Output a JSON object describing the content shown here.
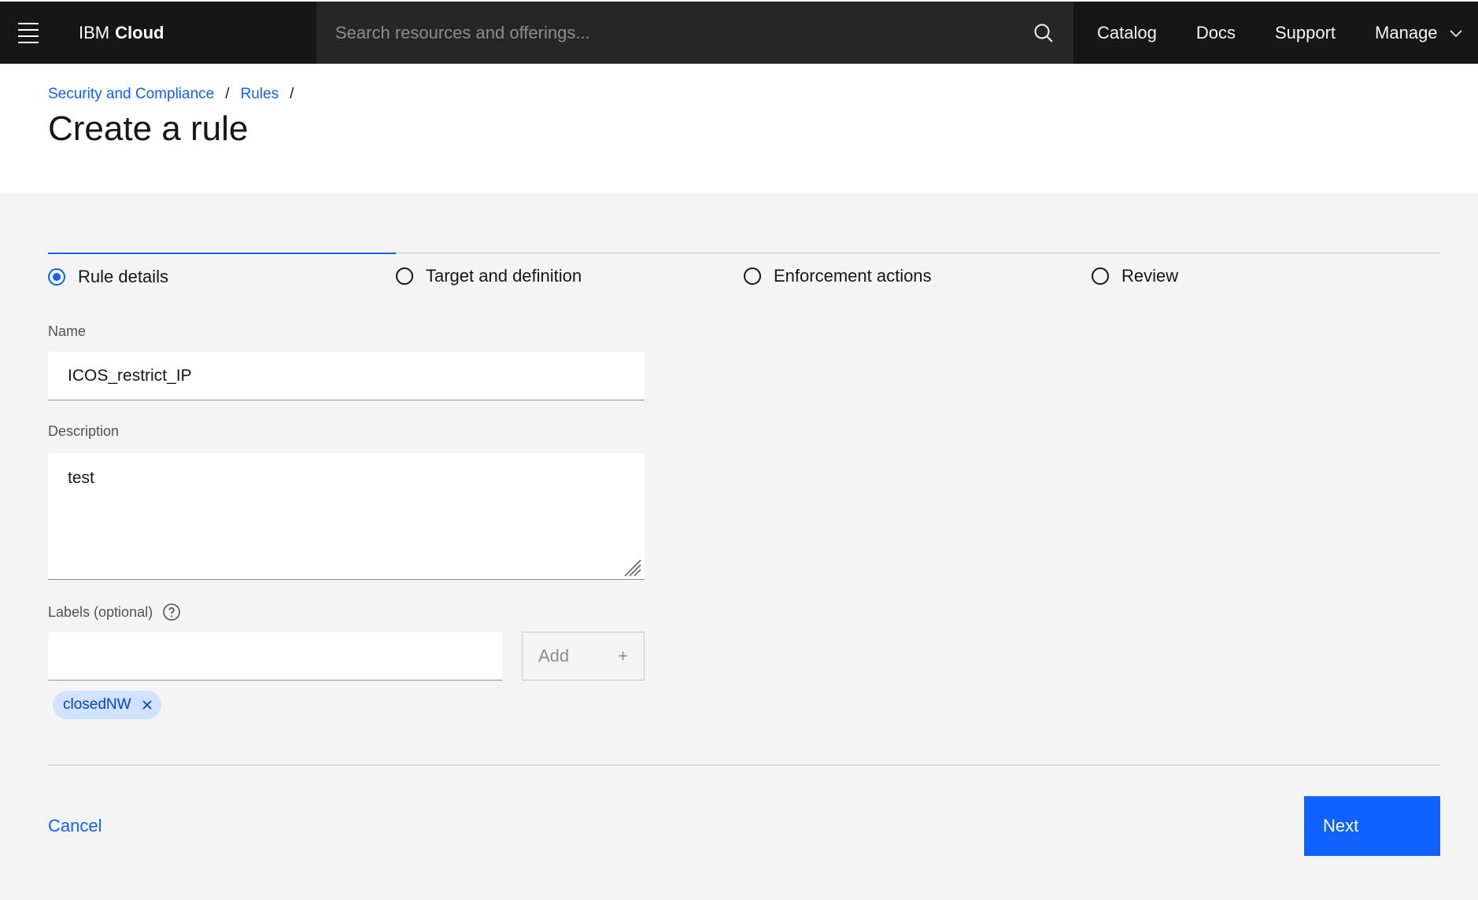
{
  "header": {
    "menu_icon": "hamburger-menu-icon",
    "brand_prefix": "IBM",
    "brand_name": "Cloud",
    "search_placeholder": "Search resources and offerings...",
    "nav": [
      "Catalog",
      "Docs",
      "Support",
      "Manage"
    ]
  },
  "breadcrumb": {
    "items": [
      "Security and Compliance",
      "Rules"
    ],
    "separator": "/"
  },
  "page": {
    "title": "Create a rule"
  },
  "steps": [
    {
      "label": "Rule details",
      "state": "current"
    },
    {
      "label": "Target and definition",
      "state": "incomplete"
    },
    {
      "label": "Enforcement actions",
      "state": "incomplete"
    },
    {
      "label": "Review",
      "state": "incomplete"
    }
  ],
  "form": {
    "name_label": "Name",
    "name_value": "ICOS_restrict_IP",
    "description_label": "Description",
    "description_value": "test",
    "labels_label": "Labels (optional)",
    "labels_input_value": "",
    "add_label": "Add",
    "add_symbol": "+",
    "tags": [
      "closedNW"
    ]
  },
  "footer": {
    "cancel_label": "Cancel",
    "next_label": "Next"
  },
  "colors": {
    "header_bg": "#161616",
    "search_bg": "#262626",
    "primary": "#0f62fe",
    "tag_bg": "#d0e2ff",
    "main_bg": "#f4f4f4"
  }
}
